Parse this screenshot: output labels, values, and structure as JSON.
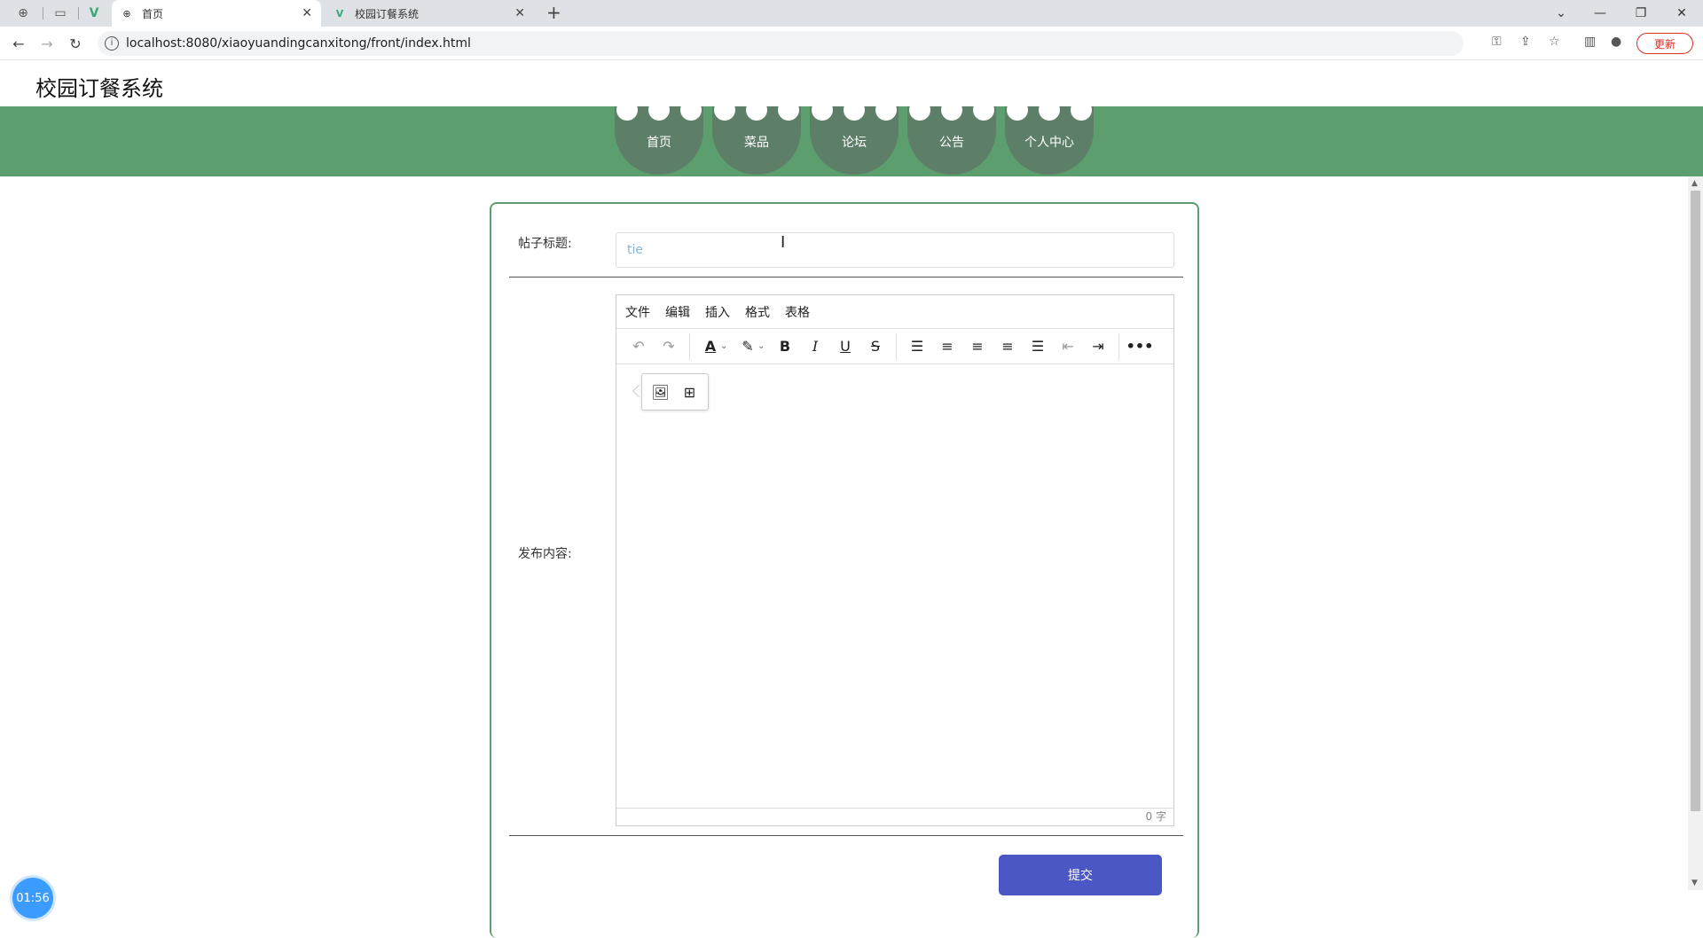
{
  "browser": {
    "tabs": [
      {
        "title": "首页",
        "active": true
      },
      {
        "title": "校园订餐系统",
        "active": false
      }
    ],
    "url": "localhost:8080/xiaoyuandingcanxitong/front/index.html",
    "update_label": "更新"
  },
  "site": {
    "title": "校园订餐系统",
    "nav": [
      "首页",
      "菜品",
      "论坛",
      "公告",
      "个人中心"
    ]
  },
  "form": {
    "title_label": "帖子标题:",
    "title_value": "tie",
    "content_label": "发布内容:",
    "editor": {
      "menus": [
        "文件",
        "编辑",
        "插入",
        "格式",
        "表格"
      ],
      "word_count": "0 字"
    },
    "submit_label": "提交"
  },
  "timer": "01:56",
  "colors": {
    "nav_band": "#5c9e6d",
    "nav_item": "#5d7f68",
    "submit": "#4a57c5",
    "card_border": "#5c9e6d"
  }
}
